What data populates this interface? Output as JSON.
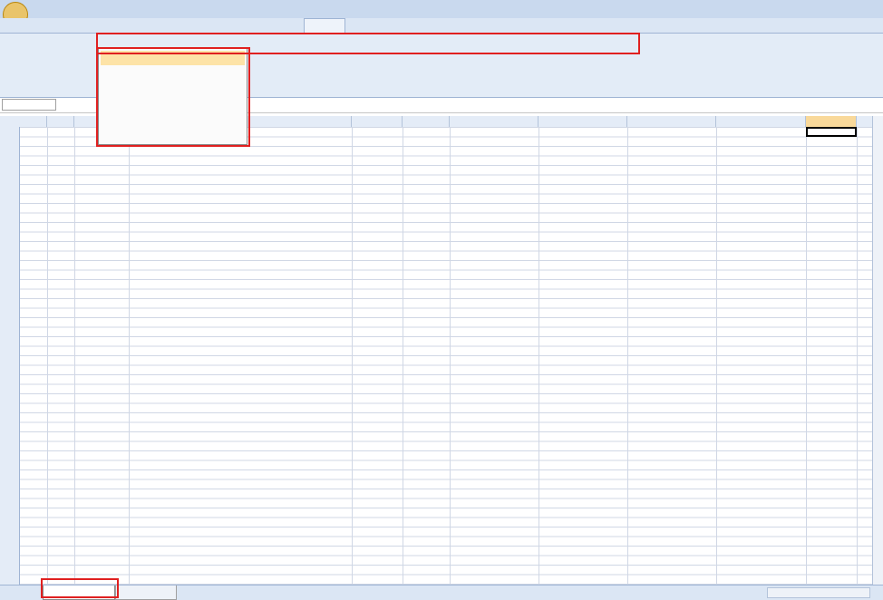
{
  "colors": {
    "ribbon_bg": "#e3ecf7",
    "menu_highlight": "#fde3a7",
    "annotation_box": "#e02020",
    "selected_column": "#f9d99a",
    "gridline": "#d0d7e5"
  }
}
